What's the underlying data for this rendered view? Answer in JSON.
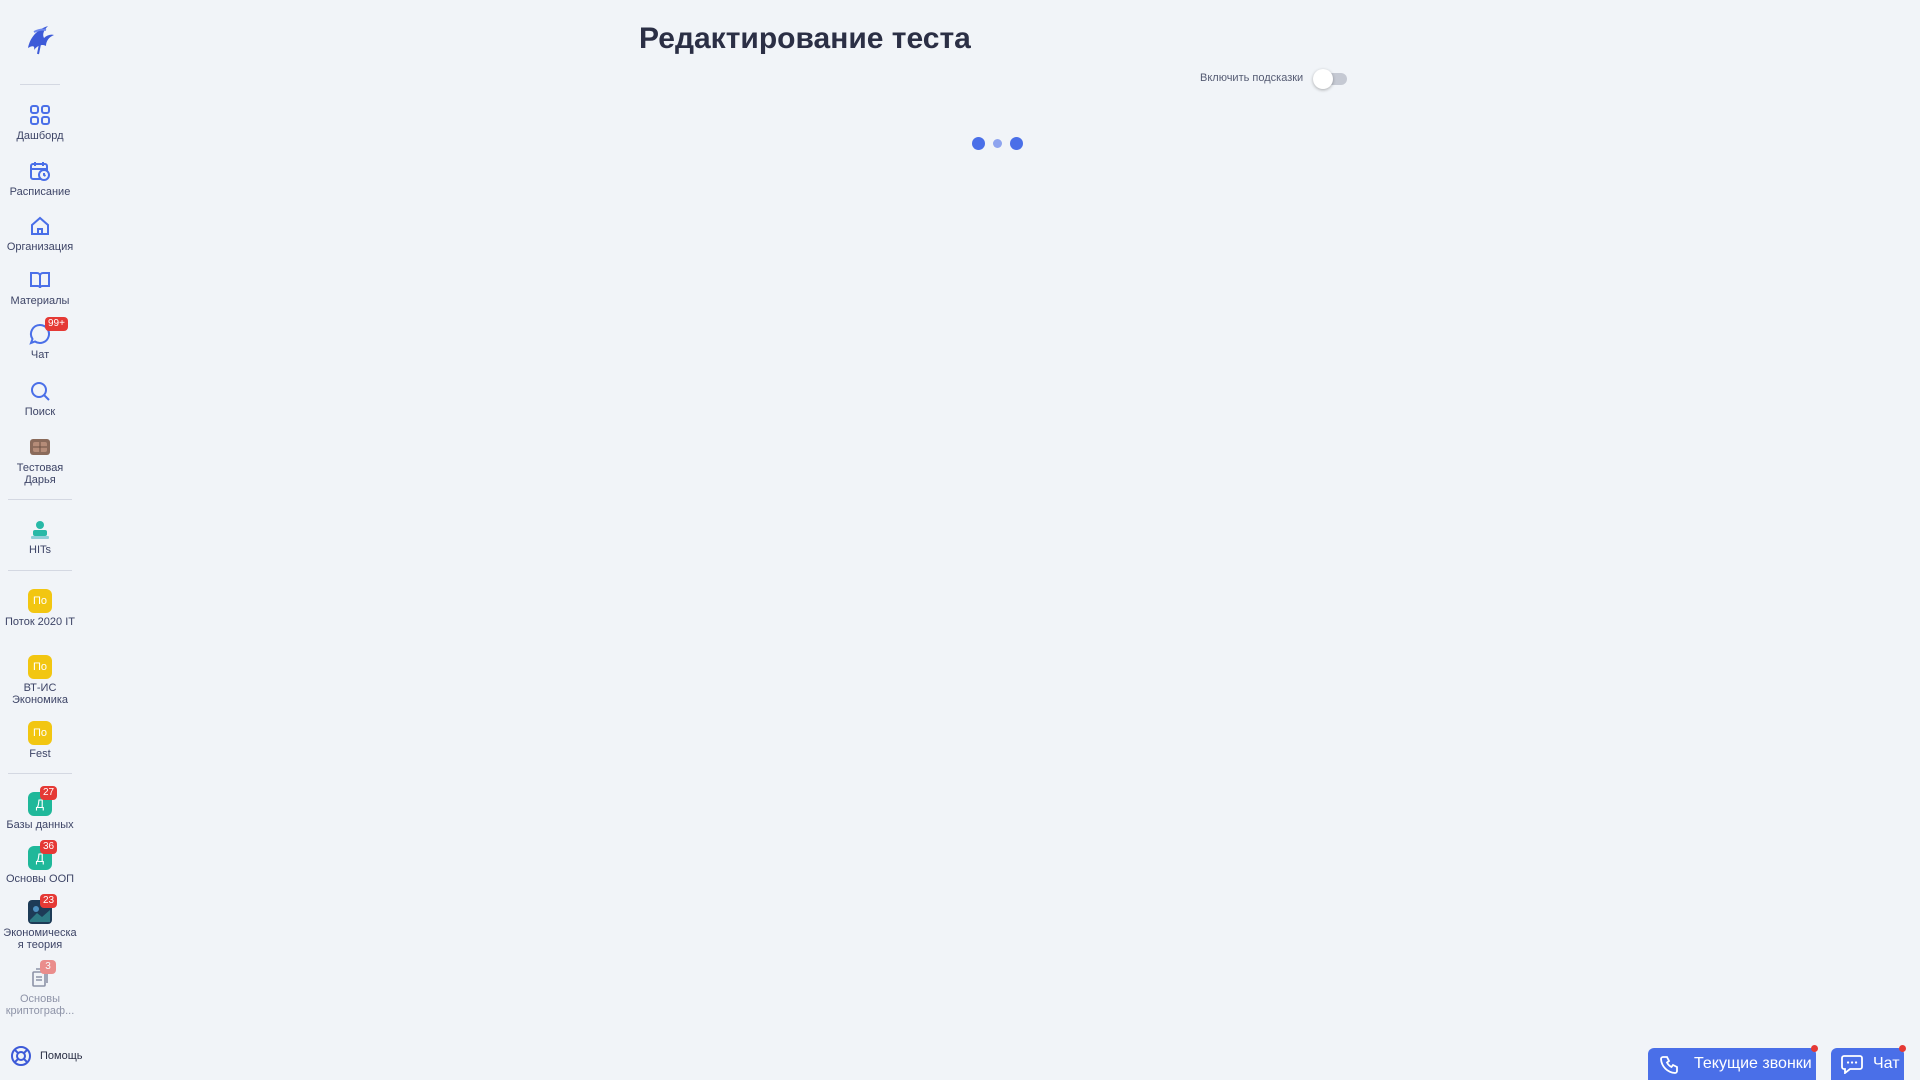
{
  "page": {
    "title": "Редактирование теста",
    "hints_label": "Включить подсказки",
    "hints_enabled": false
  },
  "sidebar": {
    "nav": [
      {
        "label": "Дашборд",
        "icon": "dashboard-icon"
      },
      {
        "label": "Расписание",
        "icon": "calendar-clock-icon"
      },
      {
        "label": "Организация",
        "icon": "home-icon"
      },
      {
        "label": "Материалы",
        "icon": "book-icon"
      },
      {
        "label": "Чат",
        "icon": "chat-icon",
        "badge": "99+"
      },
      {
        "label": "Поиск",
        "icon": "search-icon"
      },
      {
        "label": "Тестовая Дарья",
        "icon": "user-avatar"
      }
    ],
    "org": {
      "label": "HITs",
      "icon": "hits-logo"
    },
    "groups": [
      {
        "label": "Поток 2020 IT",
        "avatar": "По"
      },
      {
        "label": "ВТ-ИС Экономика",
        "avatar": "По"
      },
      {
        "label": "Fest",
        "avatar": "По"
      }
    ],
    "courses": [
      {
        "label": "Базы данных",
        "avatar": "Д",
        "badge": "27"
      },
      {
        "label": "Основы ООП",
        "avatar": "Д",
        "badge": "36"
      },
      {
        "label": "Экономическая теория",
        "badge": "23"
      },
      {
        "label": "Основы криптограф...",
        "badge": "3"
      }
    ],
    "help_label": "Помощь"
  },
  "footer": {
    "calls_label": "Текущие звонки",
    "chat_label": "Чат"
  },
  "colors": {
    "accent": "#4a6fe8",
    "badge": "#e53935",
    "group_avatar": "#f2c611",
    "course_avatar": "#1fb89a",
    "background": "#f1f4f8"
  }
}
